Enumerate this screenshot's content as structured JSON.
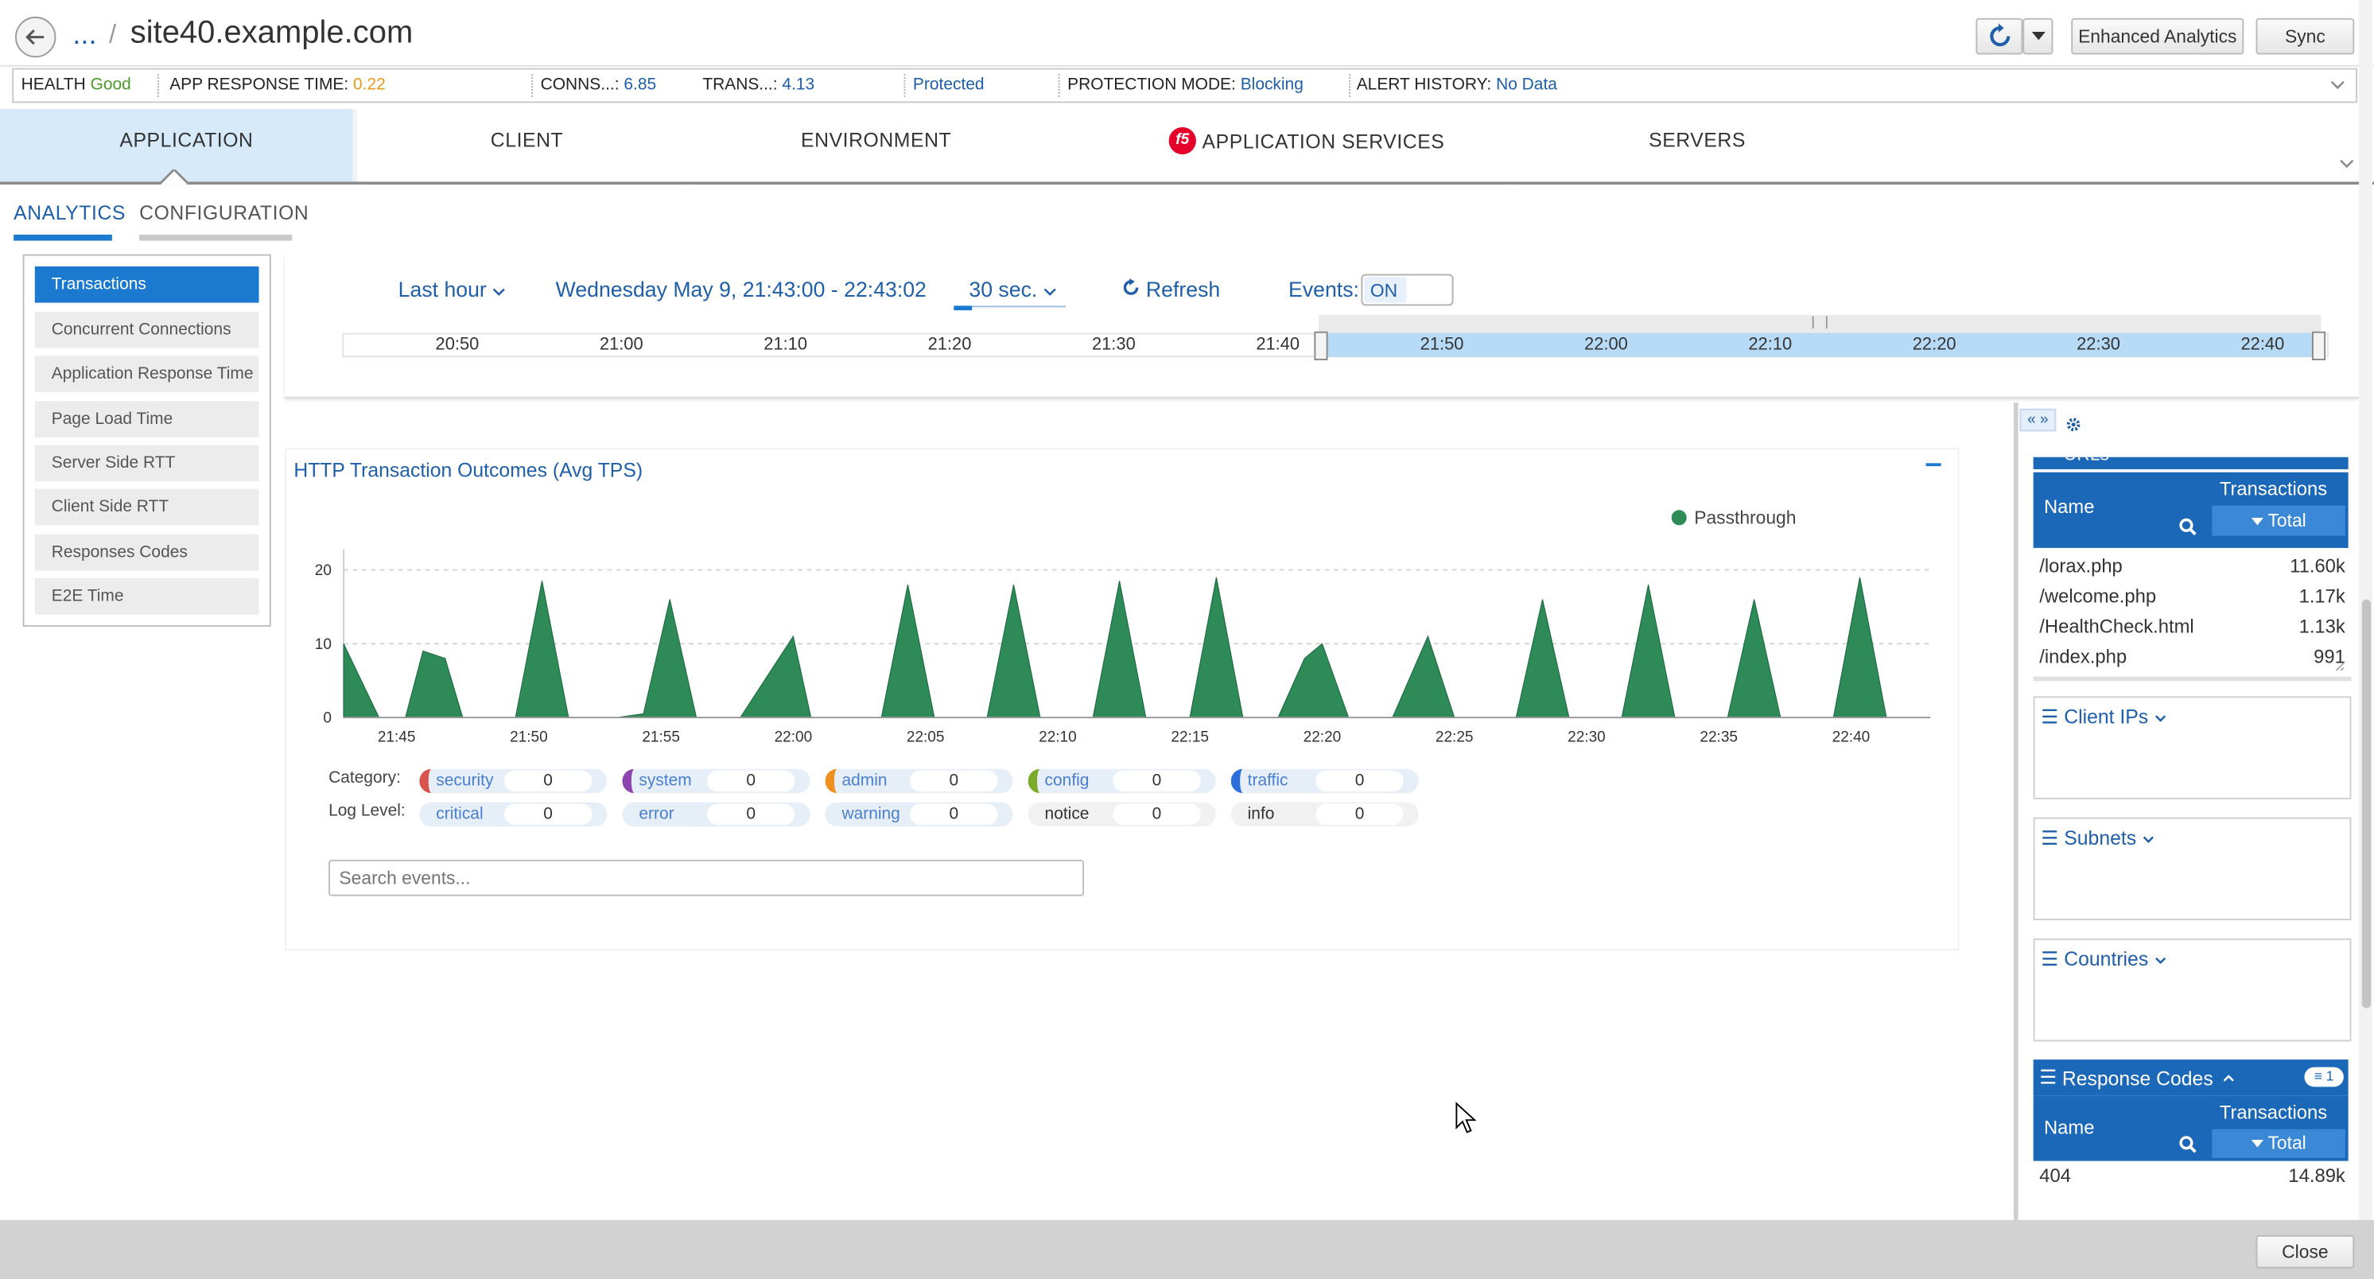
{
  "header": {
    "breadcrumb_ellipsis": "...",
    "breadcrumb_sep": "/",
    "site_title": "site40.example.com",
    "enhanced_analytics_label": "Enhanced Analytics",
    "sync_label": "Sync"
  },
  "status_bar": {
    "health_label": "HEALTH",
    "health_value": "Good",
    "app_response_label": "APP RESPONSE TIME:",
    "app_response_value": "0.22",
    "conns_label": "CONNS...:",
    "conns_value": "6.85",
    "trans_label": "TRANS...:",
    "trans_value": "4.13",
    "protected_label": "Protected",
    "protection_mode_label": "PROTECTION MODE:",
    "protection_mode_value": "Blocking",
    "alert_history_label": "ALERT HISTORY:",
    "alert_history_value": "No Data"
  },
  "nav_tabs": [
    "APPLICATION",
    "CLIENT",
    "ENVIRONMENT",
    "APPLICATION SERVICES",
    "SERVERS"
  ],
  "f5_badge": "f5",
  "sub_tabs": [
    "ANALYTICS",
    "CONFIGURATION"
  ],
  "left_menu": [
    "Transactions",
    "Concurrent Connections",
    "Application Response Time",
    "Page Load Time",
    "Server Side RTT",
    "Client Side RTT",
    "Responses Codes",
    "E2E Time"
  ],
  "time_controls": {
    "range_label": "Last hour",
    "date_range": "Wednesday May 9, 21:43:00 - 22:43:02",
    "interval_label": "30 sec.",
    "refresh_label": "Refresh",
    "events_label": "Events:",
    "events_toggle": "ON",
    "timeline_ticks": [
      "20:50",
      "21:00",
      "21:10",
      "21:20",
      "21:30",
      "21:40",
      "21:50",
      "22:00",
      "22:10",
      "22:20",
      "22:30",
      "22:40"
    ]
  },
  "chart_panel": {
    "title": "HTTP Transaction Outcomes (Avg TPS)",
    "collapse_label": "−"
  },
  "chart_data": {
    "type": "area",
    "title": "HTTP Transaction Outcomes (Avg TPS)",
    "x_tick_labels": [
      "21:45",
      "21:50",
      "21:55",
      "22:00",
      "22:05",
      "22:10",
      "22:15",
      "22:20",
      "22:25",
      "22:30",
      "22:35",
      "22:40"
    ],
    "y_ticks": [
      0,
      10,
      20
    ],
    "ylim": [
      0,
      24
    ],
    "grid": true,
    "legend": "top-right",
    "series": [
      {
        "name": "Passthrough",
        "color": "#2e8b57",
        "points": [
          [
            "21:43:00",
            10
          ],
          [
            "21:43:40",
            5
          ],
          [
            "21:44:20",
            0
          ],
          [
            "21:45:20",
            0
          ],
          [
            "21:46:00",
            9
          ],
          [
            "21:46:50",
            8
          ],
          [
            "21:47:30",
            0
          ],
          [
            "21:49:30",
            0
          ],
          [
            "21:50:30",
            18.5
          ],
          [
            "21:51:30",
            0
          ],
          [
            "21:53:20",
            0
          ],
          [
            "21:54:20",
            0.5
          ],
          [
            "21:55:20",
            16
          ],
          [
            "21:56:20",
            0
          ],
          [
            "21:58:00",
            0
          ],
          [
            "22:00:00",
            11
          ],
          [
            "22:00:40",
            0
          ],
          [
            "22:03:20",
            0
          ],
          [
            "22:04:20",
            18
          ],
          [
            "22:05:20",
            0
          ],
          [
            "22:07:20",
            0
          ],
          [
            "22:08:20",
            18
          ],
          [
            "22:09:20",
            0
          ],
          [
            "22:11:20",
            0
          ],
          [
            "22:12:20",
            18.5
          ],
          [
            "22:13:20",
            0
          ],
          [
            "22:15:00",
            0
          ],
          [
            "22:16:00",
            19
          ],
          [
            "22:17:00",
            0
          ],
          [
            "22:18:20",
            0
          ],
          [
            "22:19:20",
            8
          ],
          [
            "22:20:00",
            10
          ],
          [
            "22:21:00",
            0
          ],
          [
            "22:22:40",
            0
          ],
          [
            "22:24:00",
            11
          ],
          [
            "22:25:00",
            0
          ],
          [
            "22:27:20",
            0
          ],
          [
            "22:28:20",
            16
          ],
          [
            "22:29:20",
            0
          ],
          [
            "22:31:20",
            0
          ],
          [
            "22:32:20",
            18
          ],
          [
            "22:33:20",
            0
          ],
          [
            "22:35:20",
            0
          ],
          [
            "22:36:20",
            16
          ],
          [
            "22:37:20",
            0
          ],
          [
            "22:39:20",
            0
          ],
          [
            "22:40:20",
            19
          ],
          [
            "22:41:20",
            0
          ],
          [
            "22:43:00",
            0
          ]
        ]
      }
    ]
  },
  "filters": {
    "category_label": "Category:",
    "log_level_label": "Log Level:",
    "categories": [
      {
        "label": "security",
        "count": "0",
        "color": "#d9534f"
      },
      {
        "label": "system",
        "count": "0",
        "color": "#8e44ad"
      },
      {
        "label": "admin",
        "count": "0",
        "color": "#f0901e"
      },
      {
        "label": "config",
        "count": "0",
        "color": "#7caa2a"
      },
      {
        "label": "traffic",
        "count": "0",
        "color": "#2b6fdd"
      }
    ],
    "log_levels": [
      {
        "label": "critical",
        "count": "0"
      },
      {
        "label": "error",
        "count": "0"
      },
      {
        "label": "warning",
        "count": "0"
      },
      {
        "label": "notice",
        "count": "0"
      },
      {
        "label": "info",
        "count": "0"
      }
    ],
    "search_placeholder": "Search events..."
  },
  "right_panel": {
    "urls_title": "URLs",
    "col_name": "Name",
    "col_transactions": "Transactions",
    "col_total": "Total",
    "urls": [
      {
        "name": "/lorax.php",
        "value": "11.60k"
      },
      {
        "name": "/welcome.php",
        "value": "1.17k"
      },
      {
        "name": "/HealthCheck.html",
        "value": "1.13k"
      },
      {
        "name": "/index.php",
        "value": "991"
      }
    ],
    "client_ips_title": "Client IPs",
    "subnets_title": "Subnets",
    "countries_title": "Countries",
    "response_codes_title": "Response Codes",
    "response_codes_badge": "1",
    "response_codes": [
      {
        "name": "404",
        "value": "14.89k"
      }
    ]
  },
  "footer": {
    "close_label": "Close"
  }
}
